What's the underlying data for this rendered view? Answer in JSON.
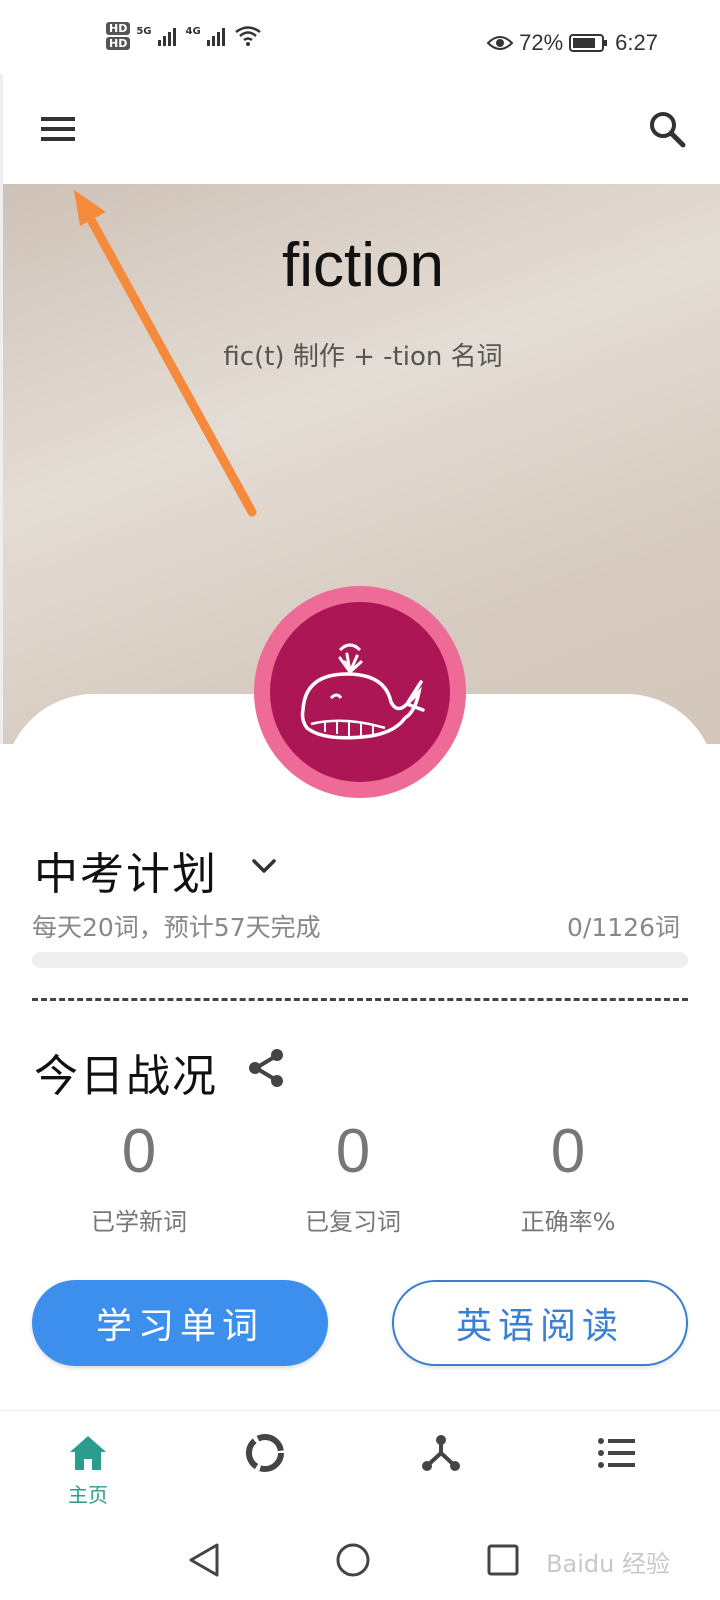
{
  "status_bar": {
    "hd1": "HD",
    "hd2": "HD",
    "net1": "5G",
    "net2": "4G",
    "battery_percent": "72%",
    "time": "6:27",
    "icons": [
      "signal-icon",
      "wifi-icon",
      "eye-icon",
      "battery-icon"
    ]
  },
  "app_bar": {
    "icons": [
      "menu-icon",
      "search-icon"
    ]
  },
  "hero": {
    "word": "fiction",
    "note": "fic(t) 制作 + -tion 名词"
  },
  "plan": {
    "title": "中考计划",
    "description": "每天20词，预计57天完成",
    "count": "0/1126词",
    "progress": 0
  },
  "today": {
    "title": "今日战况",
    "stats": [
      {
        "value": "0",
        "label": "已学新词"
      },
      {
        "value": "0",
        "label": "已复习词"
      },
      {
        "value": "0",
        "label": "正确率%"
      }
    ]
  },
  "actions": {
    "learn": "学习单词",
    "read": "英语阅读"
  },
  "bottom_nav": {
    "home_label": "主页",
    "active_color": "#2a9d8f",
    "icons": [
      "home-icon",
      "ring-icon",
      "network-icon",
      "list-icon"
    ]
  },
  "system_nav": {
    "icons": [
      "back-icon",
      "home-circle-icon",
      "recents-icon"
    ],
    "watermark": "Baidu 经验"
  },
  "colors": {
    "avatar_bg": "#ad1654",
    "avatar_ring": "#ee6b98",
    "primary": "#3d8fee",
    "annotation_arrow": "#f5893c"
  }
}
